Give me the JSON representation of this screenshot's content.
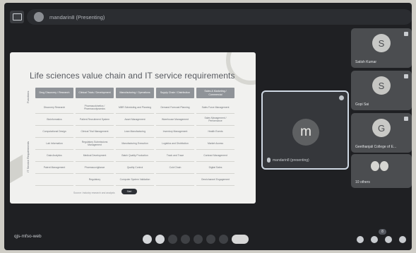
{
  "top_bar": {
    "presenting_text": "mandarin8 (Presenting)"
  },
  "slide": {
    "title": "Life sciences value chain and IT service requirements",
    "side_labels": [
      "Functions",
      "IT Service Requirements"
    ],
    "headers": [
      "Drug Discovery / Research",
      "Clinical Trials / Development",
      "Manufacturing / Operations",
      "Supply Chain / Distribution",
      "Sales & Marketing / Commercial"
    ],
    "rows": [
      [
        "Discovery Research",
        "Pharmacokinetics / Pharmacodynamics",
        "MBR Scheduling and Planning",
        "Demand Forecast Planning",
        "Sales Force Management"
      ],
      [
        "Bioinformatics",
        "Patient Recruitment System",
        "Asset Management",
        "Warehouse Management",
        "Sales Management / Performance"
      ],
      [
        "Computational Design",
        "Clinical Trial Management",
        "Lean Manufacturing",
        "Inventory Management",
        "Health Events"
      ],
      [
        "Lab Information",
        "Regulatory Submissions Management",
        "Manufacturing Execution",
        "Logistics and Distribution",
        "Market Access"
      ],
      [
        "Data Analytics",
        "Medical Development",
        "Batch Quality Production",
        "Track and Trace",
        "Contract Management"
      ],
      [
        "Patent Management",
        "Pharmacovigilance",
        "Quality Control",
        "Cold Chain",
        "Digital Sales"
      ],
      [
        "",
        "Regulatory",
        "Computer System Validation",
        "",
        "Omnichannel Engagement"
      ]
    ],
    "footer_text": "Source: Industry research and analysis",
    "button_label": "Start"
  },
  "speaker": {
    "initial": "m",
    "name": "mandarin8 (presenting)"
  },
  "participants": [
    {
      "initial": "S",
      "name": "Satish Kumar"
    },
    {
      "initial": "S",
      "name": "Gopi Sai"
    },
    {
      "initial": "G",
      "name": "Geethanjali College of E..."
    },
    {
      "initial": "",
      "name": "10 others"
    }
  ],
  "bottom_bar": {
    "meeting_code": "qjs-mfso-web",
    "participant_count": "8"
  }
}
